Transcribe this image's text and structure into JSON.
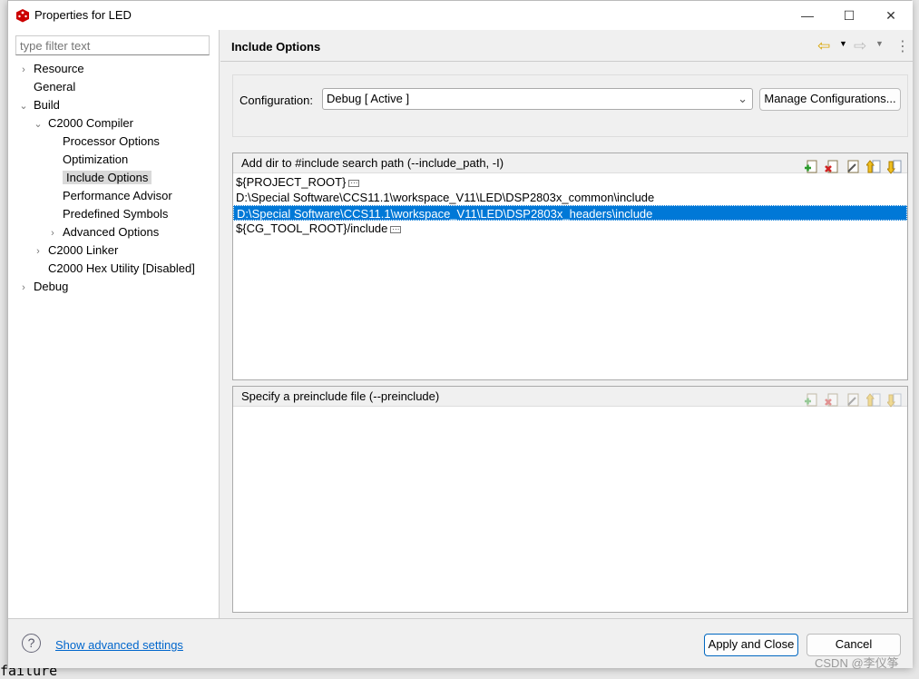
{
  "window": {
    "title": "Properties for LED",
    "minimize": "—",
    "maximize": "☐",
    "close": "✕"
  },
  "background": {
    "text": "failure"
  },
  "filter": {
    "placeholder": "type filter text"
  },
  "tree": [
    {
      "label": "Resource",
      "chev": "›",
      "indent": 0
    },
    {
      "label": "General",
      "chev": "",
      "indent": 0
    },
    {
      "label": "Build",
      "chev": "⌄",
      "indent": 0
    },
    {
      "label": "C2000 Compiler",
      "chev": "⌄",
      "indent": 1
    },
    {
      "label": "Processor Options",
      "chev": "",
      "indent": 2
    },
    {
      "label": "Optimization",
      "chev": "",
      "indent": 2
    },
    {
      "label": "Include Options",
      "chev": "",
      "indent": 2,
      "selected": true
    },
    {
      "label": "Performance Advisor",
      "chev": "",
      "indent": 2
    },
    {
      "label": "Predefined Symbols",
      "chev": "",
      "indent": 2
    },
    {
      "label": "Advanced Options",
      "chev": "›",
      "indent": 2
    },
    {
      "label": "C2000 Linker",
      "chev": "›",
      "indent": 1
    },
    {
      "label": "C2000 Hex Utility  [Disabled]",
      "chev": "",
      "indent": 1
    },
    {
      "label": "Debug",
      "chev": "›",
      "indent": 0
    }
  ],
  "page": {
    "title": "Include Options",
    "nav": {
      "back": "⇦",
      "forward": "⇨",
      "menu": "⋮"
    }
  },
  "configuration": {
    "label": "Configuration:",
    "value": "Debug  [ Active ]",
    "manage_label": "Manage Configurations..."
  },
  "include_path": {
    "header": "Add dir to #include search path (--include_path, -I)",
    "items": [
      "${PROJECT_ROOT}",
      "D:\\Special Software\\CCS11.1\\workspace_V11\\LED\\DSP2803x_common\\include",
      "D:\\Special Software\\CCS11.1\\workspace_V11\\LED\\DSP2803x_headers\\include",
      "${CG_TOOL_ROOT}/include"
    ],
    "selected_index": 2,
    "dots_on": [
      0,
      3
    ],
    "tools": [
      "add-icon",
      "delete-icon",
      "edit-icon",
      "move-up-icon",
      "move-down-icon"
    ]
  },
  "preinclude": {
    "header": "Specify a preinclude file (--preinclude)",
    "items": []
  },
  "footer": {
    "help": "?",
    "advanced_link": "Show advanced settings",
    "apply_label": "Apply and Close",
    "cancel_label": "Cancel"
  },
  "watermark": "CSDN @李仪筝",
  "colors": {
    "selection": "#0078d7",
    "link": "#0066cc",
    "logo": "#cc0000"
  }
}
